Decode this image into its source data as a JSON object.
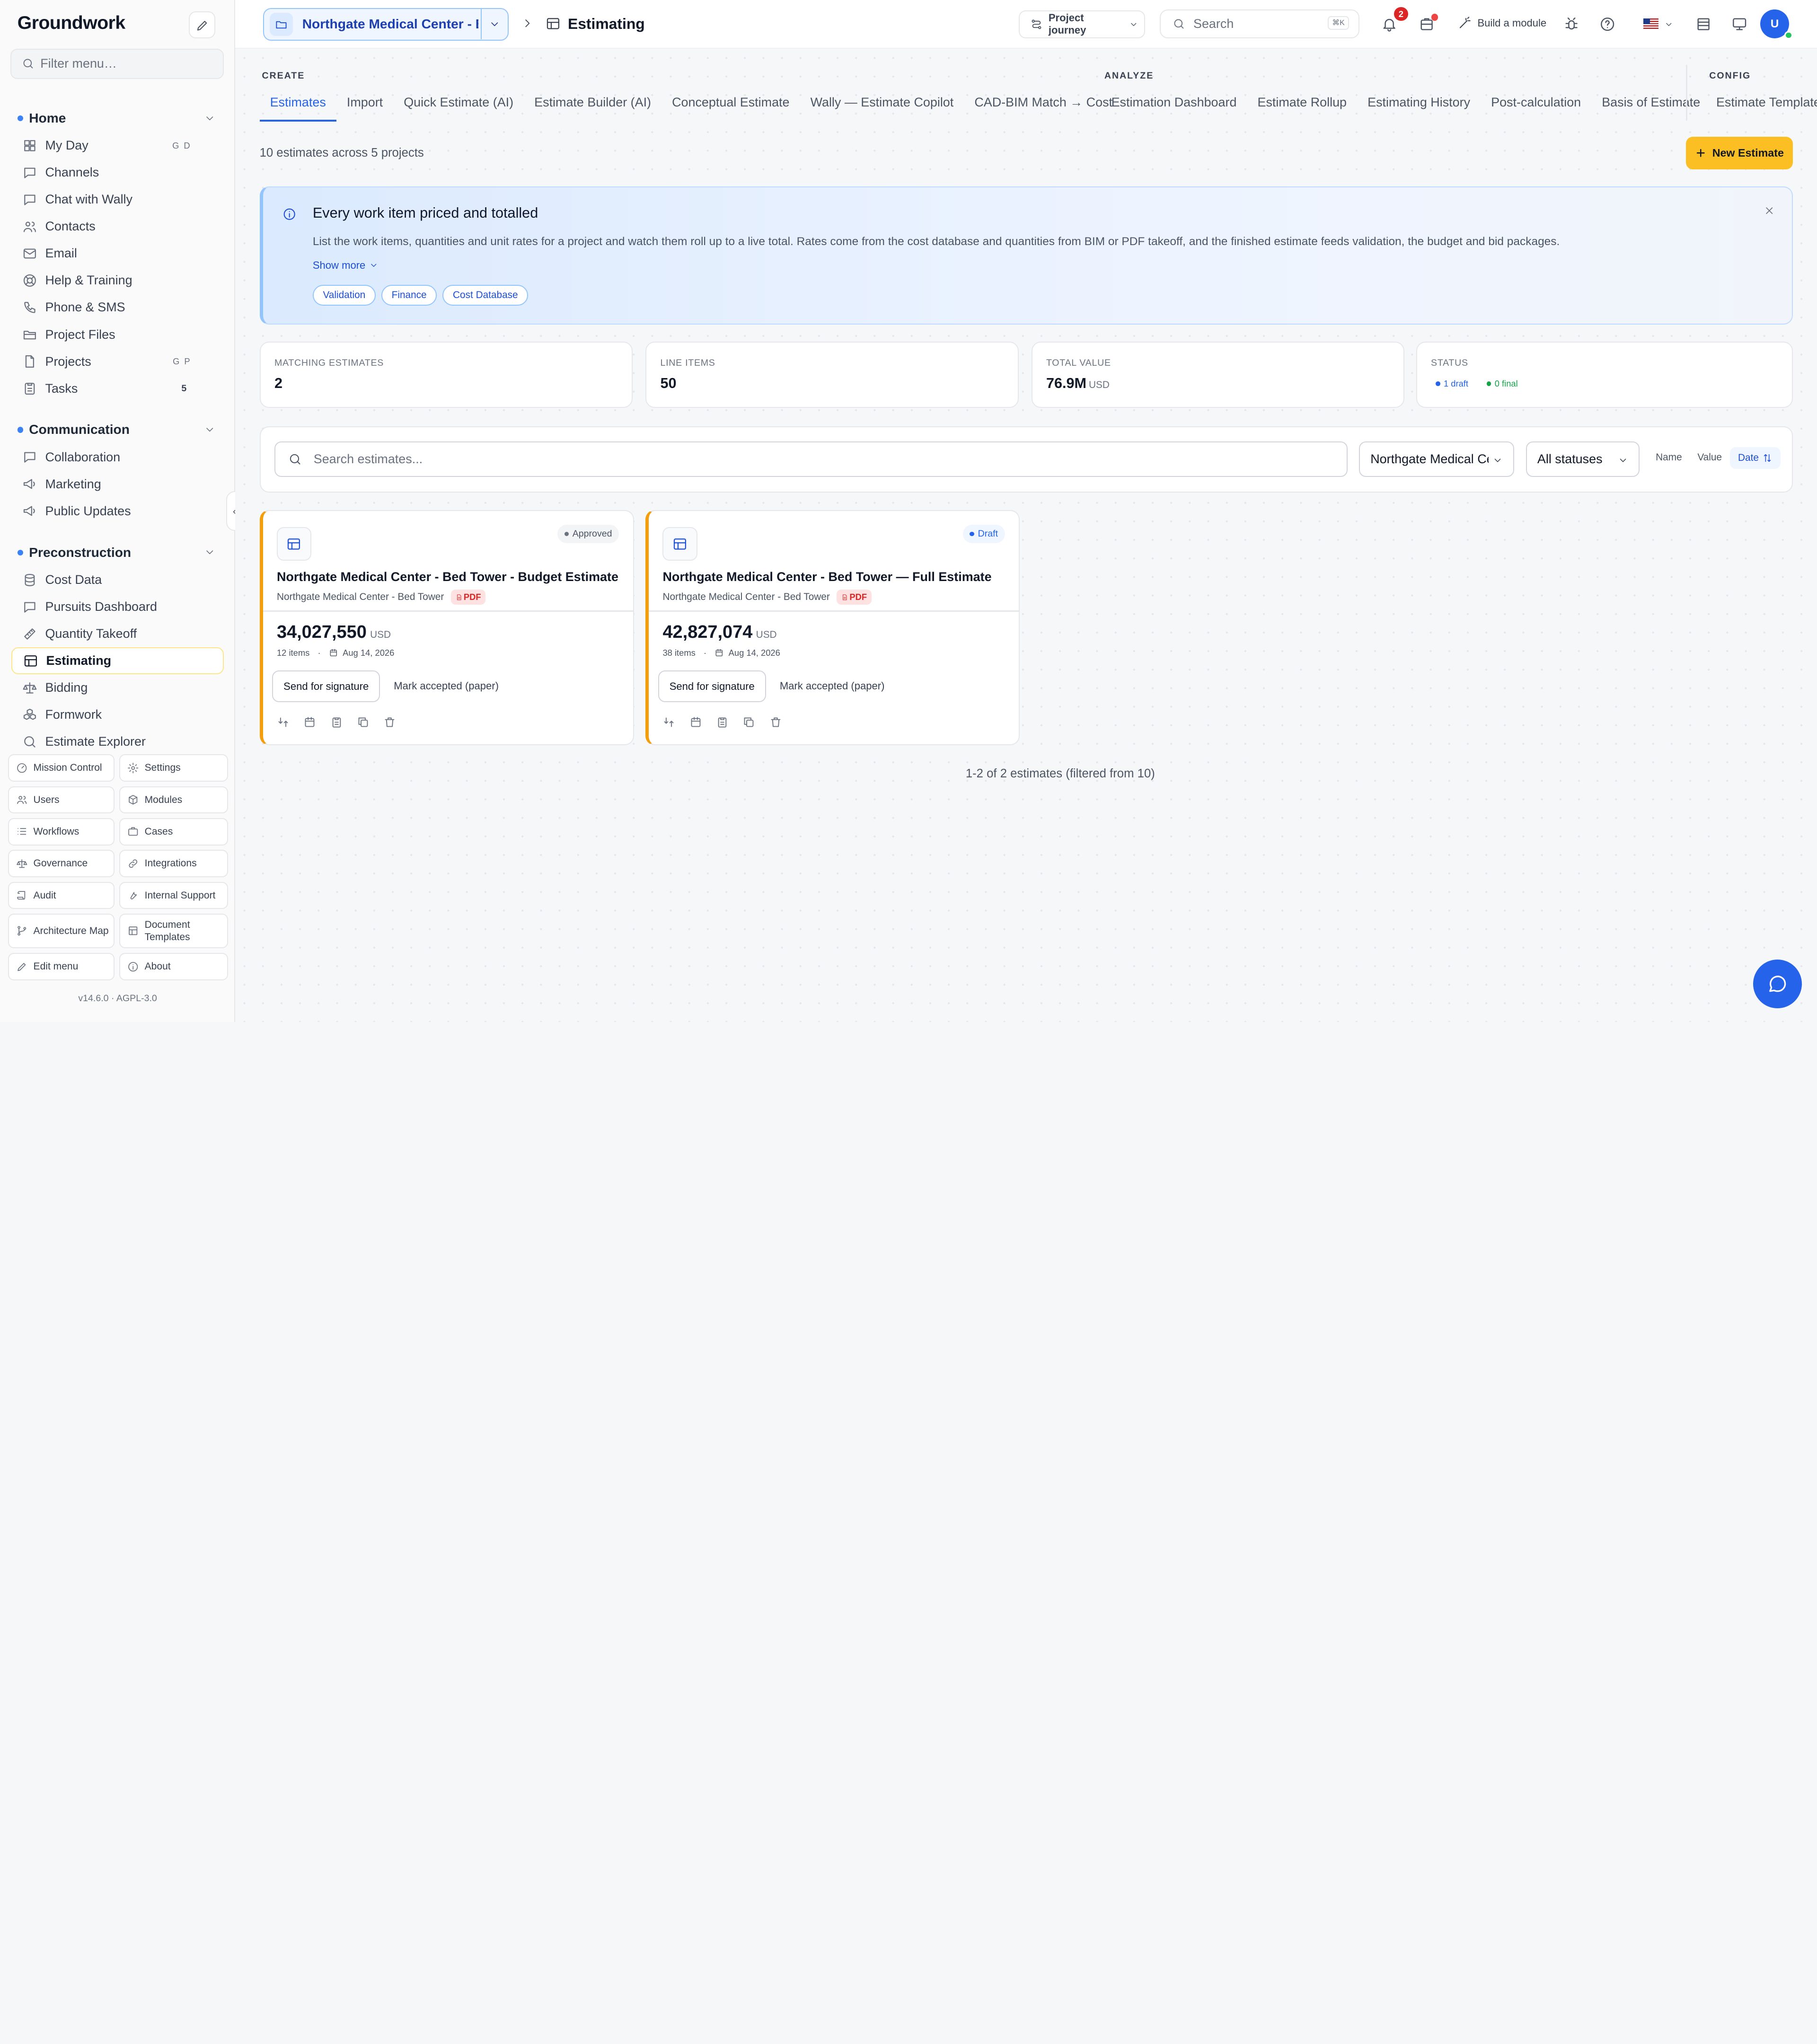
{
  "app": {
    "logo": "Groundwork",
    "filter_placeholder": "Filter menu…",
    "version": "v14.6.0 · AGPL-3.0"
  },
  "sidebar": {
    "sections": [
      {
        "title": "Home",
        "items": [
          {
            "label": "My Day",
            "icon": "grid-icon",
            "kbd": "G D"
          },
          {
            "label": "Channels",
            "icon": "chat-icon"
          },
          {
            "label": "Chat with Wally",
            "icon": "chat-icon"
          },
          {
            "label": "Contacts",
            "icon": "users-icon"
          },
          {
            "label": "Email",
            "icon": "mail-icon"
          },
          {
            "label": "Help & Training",
            "icon": "lifebuoy-icon"
          },
          {
            "label": "Phone & SMS",
            "icon": "phone-icon"
          },
          {
            "label": "Project Files",
            "icon": "folder-icon"
          },
          {
            "label": "Projects",
            "icon": "file-icon",
            "kbd": "G P"
          },
          {
            "label": "Tasks",
            "icon": "clipboard-icon",
            "count": "5"
          }
        ]
      },
      {
        "title": "Communication",
        "items": [
          {
            "label": "Collaboration",
            "icon": "chat-icon"
          },
          {
            "label": "Marketing",
            "icon": "megaphone-icon"
          },
          {
            "label": "Public Updates",
            "icon": "megaphone-icon"
          }
        ]
      },
      {
        "title": "Preconstruction",
        "items": [
          {
            "label": "Cost Data",
            "icon": "database-icon"
          },
          {
            "label": "Pursuits Dashboard",
            "icon": "chat-icon"
          },
          {
            "label": "Quantity Takeoff",
            "icon": "ruler-icon"
          },
          {
            "label": "Estimating",
            "icon": "table-icon",
            "active": true
          },
          {
            "label": "Bidding",
            "icon": "scale-icon"
          },
          {
            "label": "Formwork",
            "icon": "boxes-icon"
          },
          {
            "label": "Estimate Explorer",
            "icon": "search-icon"
          }
        ]
      }
    ],
    "bottom_buttons": [
      {
        "label": "Mission Control",
        "icon": "gauge-icon"
      },
      {
        "label": "Settings",
        "icon": "gear-icon"
      },
      {
        "label": "Users",
        "icon": "users-icon"
      },
      {
        "label": "Modules",
        "icon": "package-icon"
      },
      {
        "label": "Workflows",
        "icon": "list-icon"
      },
      {
        "label": "Cases",
        "icon": "briefcase-icon"
      },
      {
        "label": "Governance",
        "icon": "scale-icon"
      },
      {
        "label": "Integrations",
        "icon": "link-icon"
      },
      {
        "label": "Audit",
        "icon": "scroll-icon"
      },
      {
        "label": "Internal Support",
        "icon": "wrench-icon"
      },
      {
        "label": "Architecture Map",
        "icon": "branch-icon"
      },
      {
        "label": "Document Templates",
        "icon": "template-icon"
      },
      {
        "label": "Edit menu",
        "icon": "pencil-icon"
      },
      {
        "label": "About",
        "icon": "info-icon"
      }
    ]
  },
  "header": {
    "project": "Northgate Medical Center - B…",
    "breadcrumb": "Estimating",
    "journey": "Project journey",
    "search_placeholder": "Search",
    "search_shortcut": "⌘K",
    "notifications": "2",
    "build_module": "Build a module",
    "avatar": "U"
  },
  "tabs": {
    "groups": [
      "CREATE",
      "ANALYZE",
      "CONFIG"
    ],
    "create": [
      "Estimates",
      "Import",
      "Quick Estimate (AI)",
      "Estimate Builder (AI)",
      "Conceptual Estimate",
      "Wally — Estimate Copilot",
      "CAD-BIM Match → Cost"
    ],
    "analyze": [
      "Estimation Dashboard",
      "Estimate Rollup",
      "Estimating History",
      "Post-calculation",
      "Basis of Estimate"
    ],
    "config": [
      "Estimate Templates"
    ]
  },
  "summary": "10 estimates across 5 projects",
  "new_button": "New Estimate",
  "banner": {
    "title": "Every work item priced and totalled",
    "description": "List the work items, quantities and unit rates for a project and watch them roll up to a live total. Rates come from the cost database and quantities from BIM or PDF takeoff, and the finished estimate feeds validation, the budget and bid packages.",
    "show_more": "Show more",
    "chips": [
      "Validation",
      "Finance",
      "Cost Database"
    ]
  },
  "stats": {
    "matching": {
      "label": "MATCHING ESTIMATES",
      "value": "2"
    },
    "line_items": {
      "label": "LINE ITEMS",
      "value": "50"
    },
    "total": {
      "label": "TOTAL VALUE",
      "value": "76.9M",
      "unit": "USD"
    },
    "status": {
      "label": "STATUS",
      "draft": "1 draft",
      "final": "0 final"
    }
  },
  "filters": {
    "search_placeholder": "Search estimates...",
    "project": "Northgate Medical Center - Bed Tower",
    "status": "All statuses",
    "sort_name": "Name",
    "sort_value": "Value",
    "sort_date": "Date"
  },
  "estimates": [
    {
      "title": "Northgate Medical Center - Bed Tower - Budget Estimate",
      "project": "Northgate Medical Center - Bed Tower",
      "badge": "Approved",
      "file": "PDF",
      "amount": "34,027,550",
      "currency": "USD",
      "items": "12 items",
      "date": "Aug 14, 2026",
      "sign": "Send for signature",
      "mark": "Mark accepted (paper)"
    },
    {
      "title": "Northgate Medical Center - Bed Tower — Full Estimate",
      "project": "Northgate Medical Center - Bed Tower",
      "badge": "Draft",
      "file": "PDF",
      "amount": "42,827,074",
      "currency": "USD",
      "items": "38 items",
      "date": "Aug 14, 2026",
      "sign": "Send for signature",
      "mark": "Mark accepted (paper)"
    }
  ],
  "footer": "1-2 of 2 estimates (filtered from 10)",
  "colors": {
    "accent": "#2563eb",
    "primary_button": "#fbbf24",
    "card_edge": "#f59e0b",
    "draft": "#2563eb",
    "final": "#16a34a"
  }
}
